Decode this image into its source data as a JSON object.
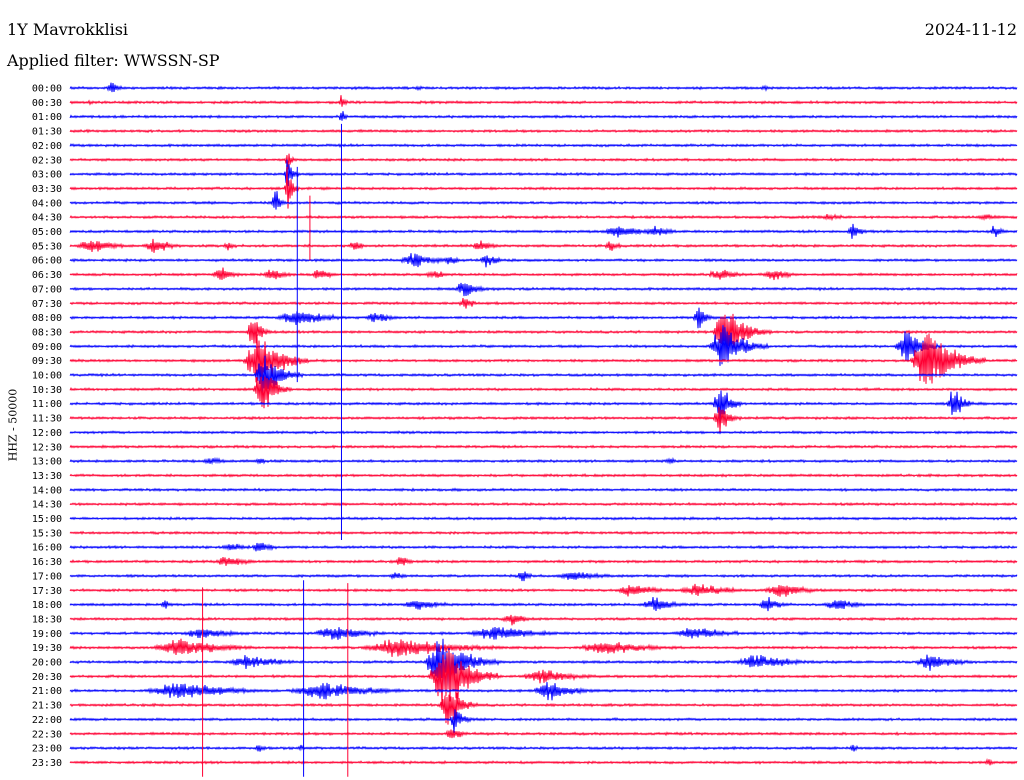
{
  "header": {
    "station": "1Y Mavrokklisi",
    "date": "2024-11-12",
    "filter_label": "Applied filter: WWSSN-SP"
  },
  "chart_data": {
    "type": "line",
    "title": "1Y Mavrokklisi",
    "ylabel": "HHZ - 50000",
    "colors": [
      "#0000ff",
      "#ff0033"
    ],
    "rows": [
      "00:00",
      "00:30",
      "01:00",
      "01:30",
      "02:00",
      "02:30",
      "03:00",
      "03:30",
      "04:00",
      "04:30",
      "05:00",
      "05:30",
      "06:00",
      "06:30",
      "07:00",
      "07:30",
      "08:00",
      "08:30",
      "09:00",
      "09:30",
      "10:00",
      "10:30",
      "11:00",
      "11:30",
      "12:00",
      "12:30",
      "13:00",
      "13:30",
      "14:00",
      "14:30",
      "15:00",
      "15:30",
      "16:00",
      "16:30",
      "17:00",
      "17:30",
      "18:00",
      "18:30",
      "19:00",
      "19:30",
      "20:00",
      "20:30",
      "21:00",
      "21:30",
      "22:00",
      "22:30",
      "23:00",
      "23:30"
    ],
    "x_range_minutes": [
      0,
      30
    ],
    "bursts": [
      {
        "row": 0,
        "minute": 1.3,
        "amp": 10,
        "dur": 0.4
      },
      {
        "row": 0,
        "minute": 11.0,
        "amp": 3,
        "dur": 0.5
      },
      {
        "row": 0,
        "minute": 22.0,
        "amp": 3,
        "dur": 0.4
      },
      {
        "row": 1,
        "minute": 0.6,
        "amp": 3,
        "dur": 0.5
      },
      {
        "row": 1,
        "minute": 8.6,
        "amp": 12,
        "dur": 0.2
      },
      {
        "row": 2,
        "minute": 8.6,
        "amp": 14,
        "dur": 0.2
      },
      {
        "row": 5,
        "minute": 6.9,
        "amp": 12,
        "dur": 0.3
      },
      {
        "row": 6,
        "minute": 6.9,
        "amp": 25,
        "dur": 0.3
      },
      {
        "row": 7,
        "minute": 6.9,
        "amp": 30,
        "dur": 0.3
      },
      {
        "row": 8,
        "minute": 6.5,
        "amp": 20,
        "dur": 0.3
      },
      {
        "row": 9,
        "minute": 24.0,
        "amp": 4,
        "dur": 1.2
      },
      {
        "row": 9,
        "minute": 29.0,
        "amp": 4,
        "dur": 1.0
      },
      {
        "row": 10,
        "minute": 17.4,
        "amp": 8,
        "dur": 1.5
      },
      {
        "row": 10,
        "minute": 18.5,
        "amp": 8,
        "dur": 1.0
      },
      {
        "row": 10,
        "minute": 24.8,
        "amp": 10,
        "dur": 0.5
      },
      {
        "row": 10,
        "minute": 29.3,
        "amp": 8,
        "dur": 0.5
      },
      {
        "row": 11,
        "minute": 0.7,
        "amp": 8,
        "dur": 1.5
      },
      {
        "row": 11,
        "minute": 2.7,
        "amp": 10,
        "dur": 1.0
      },
      {
        "row": 11,
        "minute": 5.0,
        "amp": 5,
        "dur": 0.5
      },
      {
        "row": 11,
        "minute": 9.0,
        "amp": 7,
        "dur": 0.5
      },
      {
        "row": 11,
        "minute": 13.0,
        "amp": 7,
        "dur": 0.8
      },
      {
        "row": 11,
        "minute": 17.1,
        "amp": 8,
        "dur": 0.5
      },
      {
        "row": 12,
        "minute": 10.9,
        "amp": 10,
        "dur": 1.2
      },
      {
        "row": 12,
        "minute": 13.2,
        "amp": 9,
        "dur": 0.6
      },
      {
        "row": 12,
        "minute": 12.0,
        "amp": 8,
        "dur": 0.5
      },
      {
        "row": 13,
        "minute": 4.8,
        "amp": 9,
        "dur": 0.8
      },
      {
        "row": 13,
        "minute": 6.4,
        "amp": 8,
        "dur": 0.8
      },
      {
        "row": 13,
        "minute": 7.9,
        "amp": 7,
        "dur": 0.8
      },
      {
        "row": 13,
        "minute": 11.5,
        "amp": 6,
        "dur": 0.8
      },
      {
        "row": 13,
        "minute": 20.6,
        "amp": 7,
        "dur": 1.2
      },
      {
        "row": 13,
        "minute": 22.3,
        "amp": 7,
        "dur": 1.0
      },
      {
        "row": 14,
        "minute": 12.5,
        "amp": 12,
        "dur": 0.8
      },
      {
        "row": 15,
        "minute": 12.5,
        "amp": 10,
        "dur": 0.5
      },
      {
        "row": 16,
        "minute": 7.2,
        "amp": 11,
        "dur": 1.8
      },
      {
        "row": 16,
        "minute": 9.7,
        "amp": 8,
        "dur": 0.9
      },
      {
        "row": 16,
        "minute": 19.9,
        "amp": 20,
        "dur": 0.4
      },
      {
        "row": 17,
        "minute": 5.8,
        "amp": 18,
        "dur": 0.6
      },
      {
        "row": 17,
        "minute": 20.8,
        "amp": 30,
        "dur": 1.2
      },
      {
        "row": 18,
        "minute": 20.7,
        "amp": 30,
        "dur": 1.2
      },
      {
        "row": 18,
        "minute": 26.5,
        "amp": 22,
        "dur": 1.0
      },
      {
        "row": 19,
        "minute": 6.0,
        "amp": 40,
        "dur": 1.3
      },
      {
        "row": 19,
        "minute": 27.2,
        "amp": 40,
        "dur": 1.5
      },
      {
        "row": 20,
        "minute": 6.2,
        "amp": 30,
        "dur": 1.0
      },
      {
        "row": 21,
        "minute": 6.1,
        "amp": 30,
        "dur": 0.8
      },
      {
        "row": 22,
        "minute": 28.0,
        "amp": 20,
        "dur": 0.6
      },
      {
        "row": 22,
        "minute": 20.6,
        "amp": 25,
        "dur": 0.6
      },
      {
        "row": 23,
        "minute": 20.6,
        "amp": 20,
        "dur": 0.6
      },
      {
        "row": 26,
        "minute": 4.5,
        "amp": 5,
        "dur": 1.0
      },
      {
        "row": 26,
        "minute": 6.0,
        "amp": 4,
        "dur": 0.6
      },
      {
        "row": 26,
        "minute": 19.0,
        "amp": 4,
        "dur": 0.6
      },
      {
        "row": 32,
        "minute": 5.1,
        "amp": 6,
        "dur": 1.0
      },
      {
        "row": 32,
        "minute": 6.0,
        "amp": 8,
        "dur": 0.7
      },
      {
        "row": 33,
        "minute": 5.0,
        "amp": 7,
        "dur": 1.2
      },
      {
        "row": 33,
        "minute": 10.5,
        "amp": 7,
        "dur": 0.6
      },
      {
        "row": 34,
        "minute": 10.3,
        "amp": 5,
        "dur": 0.6
      },
      {
        "row": 34,
        "minute": 14.3,
        "amp": 10,
        "dur": 0.4
      },
      {
        "row": 34,
        "minute": 16.0,
        "amp": 7,
        "dur": 1.5
      },
      {
        "row": 35,
        "minute": 17.8,
        "amp": 8,
        "dur": 1.5
      },
      {
        "row": 35,
        "minute": 19.9,
        "amp": 9,
        "dur": 1.8
      },
      {
        "row": 35,
        "minute": 22.5,
        "amp": 9,
        "dur": 1.5
      },
      {
        "row": 36,
        "minute": 3.0,
        "amp": 7,
        "dur": 0.3
      },
      {
        "row": 36,
        "minute": 11.0,
        "amp": 7,
        "dur": 1.5
      },
      {
        "row": 36,
        "minute": 18.5,
        "amp": 9,
        "dur": 1.2
      },
      {
        "row": 36,
        "minute": 22.1,
        "amp": 9,
        "dur": 0.8
      },
      {
        "row": 36,
        "minute": 24.3,
        "amp": 8,
        "dur": 1.2
      },
      {
        "row": 37,
        "minute": 14.0,
        "amp": 7,
        "dur": 1.0
      },
      {
        "row": 38,
        "minute": 4.2,
        "amp": 7,
        "dur": 2.0
      },
      {
        "row": 38,
        "minute": 8.4,
        "amp": 9,
        "dur": 2.0
      },
      {
        "row": 38,
        "minute": 13.5,
        "amp": 9,
        "dur": 2.5
      },
      {
        "row": 38,
        "minute": 19.8,
        "amp": 8,
        "dur": 2.0
      },
      {
        "row": 39,
        "minute": 3.5,
        "amp": 12,
        "dur": 2.5
      },
      {
        "row": 39,
        "minute": 10.5,
        "amp": 12,
        "dur": 3.5
      },
      {
        "row": 39,
        "minute": 17.0,
        "amp": 9,
        "dur": 2.5
      },
      {
        "row": 40,
        "minute": 5.6,
        "amp": 9,
        "dur": 2.0
      },
      {
        "row": 40,
        "minute": 11.8,
        "amp": 35,
        "dur": 1.5
      },
      {
        "row": 40,
        "minute": 21.8,
        "amp": 10,
        "dur": 2.0
      },
      {
        "row": 40,
        "minute": 27.3,
        "amp": 10,
        "dur": 1.5
      },
      {
        "row": 41,
        "minute": 11.9,
        "amp": 45,
        "dur": 1.4
      },
      {
        "row": 41,
        "minute": 15.0,
        "amp": 9,
        "dur": 2.0
      },
      {
        "row": 42,
        "minute": 3.5,
        "amp": 11,
        "dur": 3.0
      },
      {
        "row": 42,
        "minute": 8.0,
        "amp": 11,
        "dur": 3.0
      },
      {
        "row": 42,
        "minute": 15.2,
        "amp": 13,
        "dur": 1.5
      },
      {
        "row": 43,
        "minute": 12.0,
        "amp": 30,
        "dur": 0.8
      },
      {
        "row": 44,
        "minute": 12.2,
        "amp": 18,
        "dur": 0.5
      },
      {
        "row": 45,
        "minute": 12.1,
        "amp": 12,
        "dur": 0.5
      },
      {
        "row": 46,
        "minute": 6.0,
        "amp": 5,
        "dur": 0.5
      },
      {
        "row": 46,
        "minute": 7.3,
        "amp": 4,
        "dur": 0.4
      },
      {
        "row": 46,
        "minute": 24.8,
        "amp": 5,
        "dur": 0.3
      },
      {
        "row": 47,
        "minute": 29.1,
        "amp": 5,
        "dur": 0.4
      }
    ],
    "spikes": [
      {
        "minute": 8.6,
        "row_from": 2.5,
        "row_to": 31.5
      },
      {
        "minute": 4.2,
        "row_from": 34.8,
        "row_to": 48
      },
      {
        "minute": 7.4,
        "row_from": 34.3,
        "row_to": 48
      },
      {
        "minute": 8.8,
        "row_from": 34.5,
        "row_to": 48
      },
      {
        "minute": 7.2,
        "row_from": 5.5,
        "row_to": 20.5
      },
      {
        "minute": 7.6,
        "row_from": 7.5,
        "row_to": 12
      }
    ]
  }
}
